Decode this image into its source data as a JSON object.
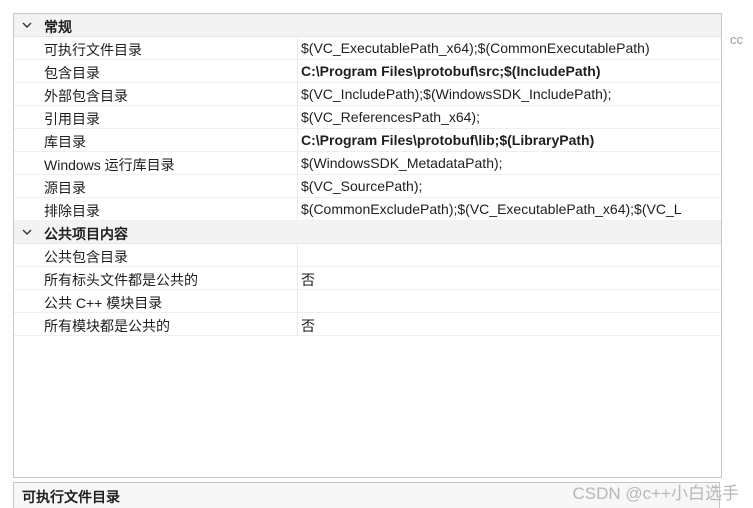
{
  "categories": [
    {
      "label": "常规",
      "rows": [
        {
          "name": "可执行文件目录",
          "value": "$(VC_ExecutablePath_x64);$(CommonExecutablePath)"
        },
        {
          "name": "包含目录",
          "value": "C:\\Program Files\\protobuf\\src;$(IncludePath)",
          "bold": true
        },
        {
          "name": "外部包含目录",
          "value": "$(VC_IncludePath);$(WindowsSDK_IncludePath);"
        },
        {
          "name": "引用目录",
          "value": "$(VC_ReferencesPath_x64);"
        },
        {
          "name": "库目录",
          "value": "C:\\Program Files\\protobuf\\lib;$(LibraryPath)",
          "bold": true
        },
        {
          "name": "Windows 运行库目录",
          "value": "$(WindowsSDK_MetadataPath);"
        },
        {
          "name": "源目录",
          "value": "$(VC_SourcePath);"
        },
        {
          "name": "排除目录",
          "value": "$(CommonExcludePath);$(VC_ExecutablePath_x64);$(VC_L"
        }
      ]
    },
    {
      "label": "公共项目内容",
      "rows": [
        {
          "name": "公共包含目录",
          "value": ""
        },
        {
          "name": "所有标头文件都是公共的",
          "value": "否"
        },
        {
          "name": "公共 C++ 模块目录",
          "value": ""
        },
        {
          "name": "所有模块都是公共的",
          "value": "否"
        }
      ]
    }
  ],
  "description": {
    "title": "可执行文件目录"
  },
  "cut_text": "cc",
  "watermark": "CSDN @c++小白选手",
  "icons": {
    "expand": "chevron-down-icon"
  },
  "colors": {
    "category_bg": "#f3f3f3",
    "border": "#c6c6c6"
  }
}
